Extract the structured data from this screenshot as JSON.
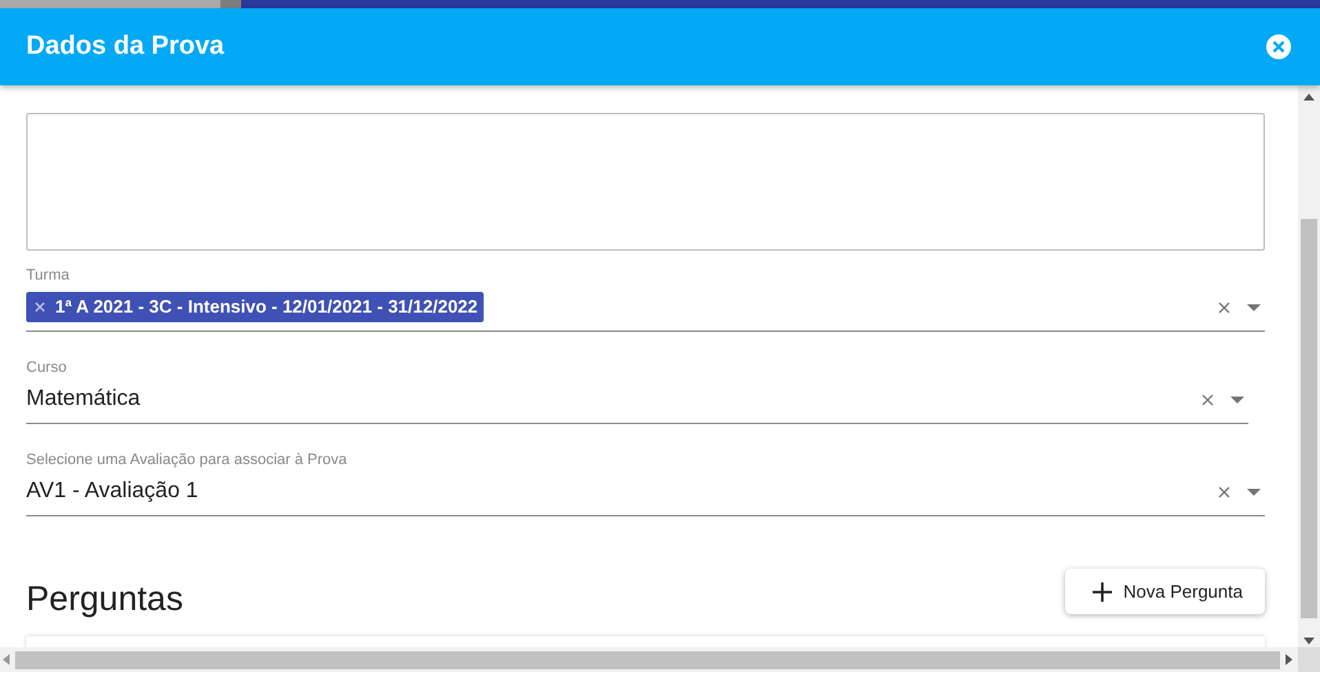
{
  "dialog": {
    "title": "Dados da Prova"
  },
  "description": {
    "kind": "textarea"
  },
  "fields": [
    {
      "label": "Turma",
      "kind": "chips",
      "chips": [
        "1ª A 2021 - 3C - Intensivo - 12/01/2021 - 31/12/2022"
      ],
      "clearable": true,
      "narrow": false
    },
    {
      "label": "Curso",
      "kind": "text",
      "value": "Matemática",
      "clearable": true,
      "narrow": true
    },
    {
      "label": "Selecione uma Avaliação para associar à Prova",
      "kind": "text",
      "value": "AV1 - Avaliação 1",
      "clearable": true,
      "narrow": false
    }
  ],
  "questions": {
    "heading": "Perguntas",
    "add_button": "Nova Pergunta"
  }
}
